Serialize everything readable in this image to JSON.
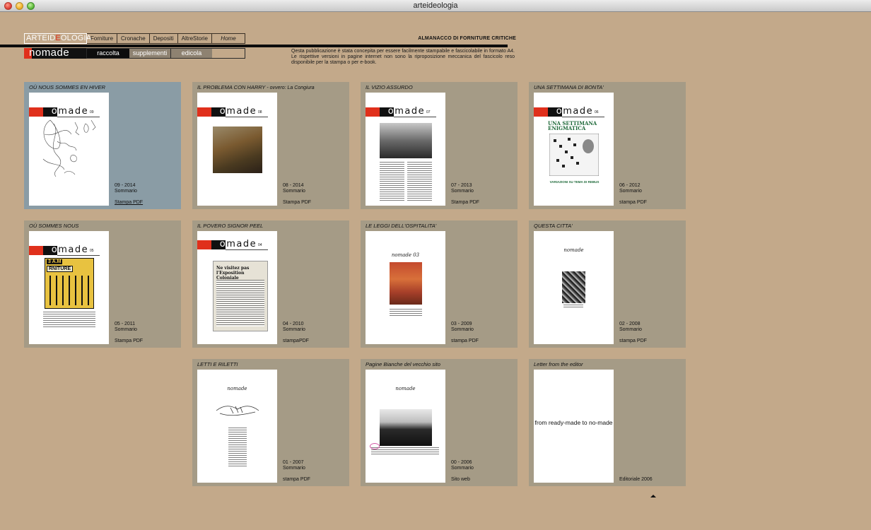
{
  "window": {
    "title": "arteideologia"
  },
  "header": {
    "logo": {
      "part1": "ARTEID",
      "part2": "E",
      "part3": "OLOGIA"
    },
    "nav": [
      "Forniture",
      "Cronache",
      "Depositi",
      "AltreStorie",
      "Home"
    ],
    "almanacco": "ALMANACCO DI FORNITURE CRITICHE",
    "brand": {
      "no": "no",
      "made": "made"
    },
    "subnav": [
      "raccolta",
      "supplementi",
      "edicola"
    ],
    "description": "Qesta pubblicazione è stata concepita per essere facilmente stampabile e fascicolabile in formato A4. Le rispettive versioni in pagine internet non sono la riproposizione meccanica del fascicolo reso disponibile per la stampa o per e-book."
  },
  "issues": [
    {
      "title": "OÙ NOUS SOMMES EN HIVER",
      "date": "09 - 2014",
      "summary": "Sommario",
      "download": "Stampa PDF",
      "issue_no": "09"
    },
    {
      "title": "IL PROBLEMA CON HARRY",
      "title_suffix": " - ovvero: La Congiura",
      "date": "08 - 2014",
      "summary": "Sommario",
      "download": "Stampa PDF",
      "issue_no": "08"
    },
    {
      "title": "IL VIZIO ASSURDO",
      "date": "07 - 2013",
      "summary": "Sommario",
      "download": "Stampa PDF",
      "issue_no": "07"
    },
    {
      "title": "UNA SETTIMANA DI BONTA'",
      "date": "06 - 2012",
      "summary": "Sommario",
      "download": "stampa PDF",
      "issue_no": "06",
      "cover_headline": "UNA SETTIMANA ENIGMATICA",
      "cover_footer": "VARIAZIONI SU TEMA DI REBUS"
    },
    {
      "title": "OÙ SOMMES NOUS",
      "date": "05 - 2011",
      "summary": "Sommario",
      "download": "Stampa PDF",
      "issue_no": "05",
      "cover_sign": "3 A.M",
      "cover_sign2": "RNITURE"
    },
    {
      "title": "IL POVERO SIGNOR PEEL",
      "date": "04 - 2010",
      "summary": "Sommario",
      "download": "stampaPDF",
      "issue_no": "04",
      "cover_text": "Ne visitez pas l'Exposition Coloniale"
    },
    {
      "title": "LE LEGGI DELL'OSPITALITA'",
      "date": "03 - 2009",
      "summary": "Sommario",
      "download": "stampa PDF",
      "issue_no": "03",
      "cover_mast": "nomade 03"
    },
    {
      "title": "QUESTA CITTA'",
      "date": "02 - 2008",
      "summary": "Sommario",
      "download": "stampa PDF",
      "issue_no": "02",
      "cover_mast": "nomade"
    },
    {
      "title": "LETTI E RILETTI",
      "date": "01 - 2007",
      "summary": "Sommario",
      "download": "stampa PDF",
      "issue_no": "01",
      "cover_mast": "nomade"
    },
    {
      "title": "Pagine Bianche del vecchio sito",
      "date": "00 - 2006",
      "summary": "Sommario",
      "download": "Sito web",
      "issue_no": "00",
      "cover_mast": "nomade"
    },
    {
      "title": "Letter from the editor",
      "download": "Editoriale 2006",
      "cover_text": "from ready-made to no-made"
    }
  ],
  "colors": {
    "background": "#c3a98a",
    "card": "#a59b86",
    "card_active": "#8a9ca5",
    "accent_red": "#e0301c"
  }
}
